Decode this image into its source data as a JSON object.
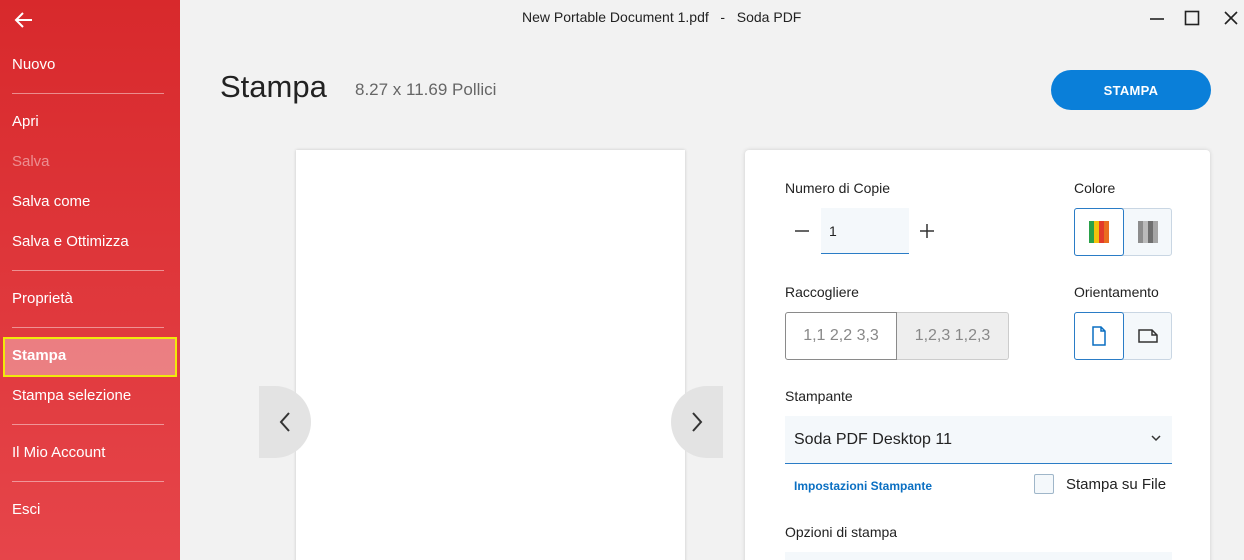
{
  "window": {
    "title": "New Portable Document 1.pdf   -   Soda PDF"
  },
  "sidebar": {
    "items": [
      {
        "label": "Nuovo"
      },
      {
        "label": "Apri"
      },
      {
        "label": "Salva"
      },
      {
        "label": "Salva come"
      },
      {
        "label": "Salva e Ottimizza"
      },
      {
        "label": "Proprietà"
      },
      {
        "label": "Stampa"
      },
      {
        "label": "Stampa selezione"
      },
      {
        "label": "Il Mio Account"
      },
      {
        "label": "Esci"
      }
    ]
  },
  "header": {
    "title": "Stampa",
    "page_size": "8.27 x 11.69 Pollici",
    "print_button": "STAMPA"
  },
  "settings": {
    "copies_label": "Numero di Copie",
    "copies_value": "1",
    "color_label": "Colore",
    "collate_label": "Raccogliere",
    "collate_options": [
      "1,1 2,2 3,3",
      "1,2,3 1,2,3"
    ],
    "orientation_label": "Orientamento",
    "printer_label": "Stampante",
    "printer_value": "Soda PDF Desktop 11",
    "printer_settings_link": "Impostazioni Stampante",
    "print_to_file_label": "Stampa su File",
    "print_options_label": "Opzioni di stampa"
  },
  "colors": {
    "sidebar_top": "#d8292c",
    "sidebar_bottom": "#e6454a",
    "accent": "#0a7fd9",
    "highlight": "#f1e90b"
  },
  "icons": {
    "back": "arrow-left-icon",
    "minimize": "minimize-icon",
    "maximize": "maximize-icon",
    "close": "close-icon"
  }
}
